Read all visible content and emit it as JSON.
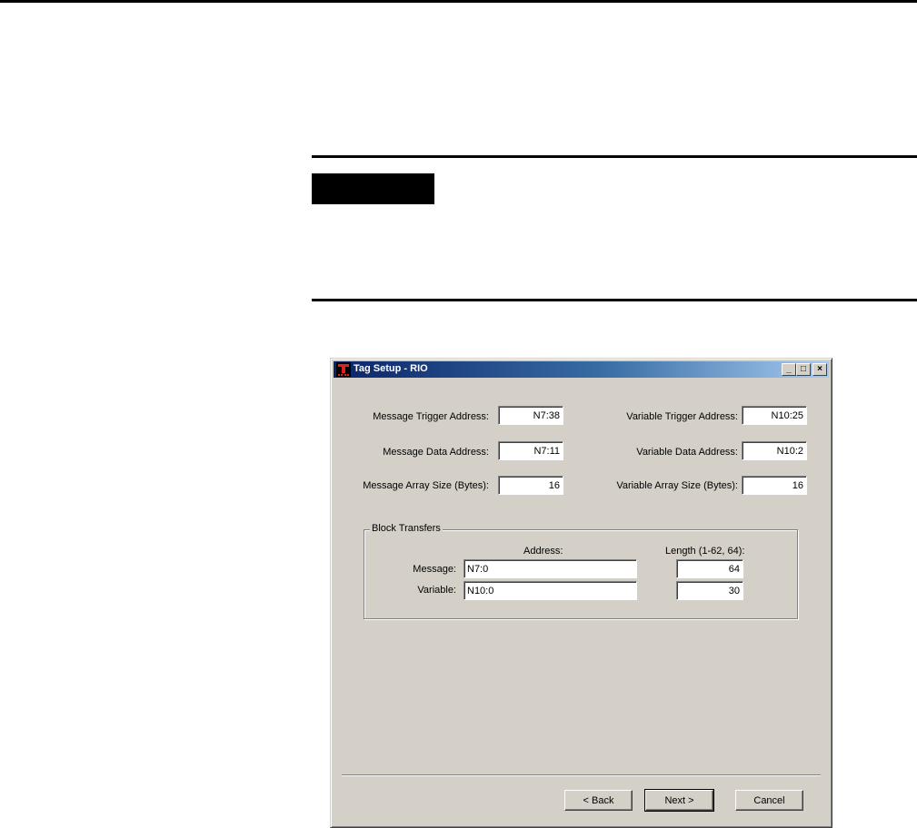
{
  "window": {
    "title": "Tag Setup - RIO",
    "minimize": "_",
    "maximize": "□",
    "close": "×"
  },
  "fields": {
    "message_trigger_address": {
      "label": "Message Trigger Address:",
      "value": "N7:38"
    },
    "message_data_address": {
      "label": "Message Data Address:",
      "value": "N7:11"
    },
    "message_array_size": {
      "label": "Message Array Size (Bytes):",
      "value": "16"
    },
    "variable_trigger_address": {
      "label": "Variable Trigger Address:",
      "value": "N10:25"
    },
    "variable_data_address": {
      "label": "Variable Data Address:",
      "value": "N10:2"
    },
    "variable_array_size": {
      "label": "Variable Array Size (Bytes):",
      "value": "16"
    }
  },
  "block_transfers": {
    "title": "Block Transfers",
    "address_header": "Address:",
    "length_header": "Length (1-62, 64):",
    "rows": [
      {
        "label": "Message:",
        "address": "N7:0",
        "length": "64"
      },
      {
        "label": "Variable:",
        "address": "N10:0",
        "length": "30"
      }
    ]
  },
  "buttons": {
    "back": "< Back",
    "next": "Next >",
    "cancel": "Cancel"
  },
  "colors": {
    "dialog_face": "#d4d0c8",
    "titlebar_start": "#0a246a",
    "titlebar_end": "#a6caf0"
  }
}
